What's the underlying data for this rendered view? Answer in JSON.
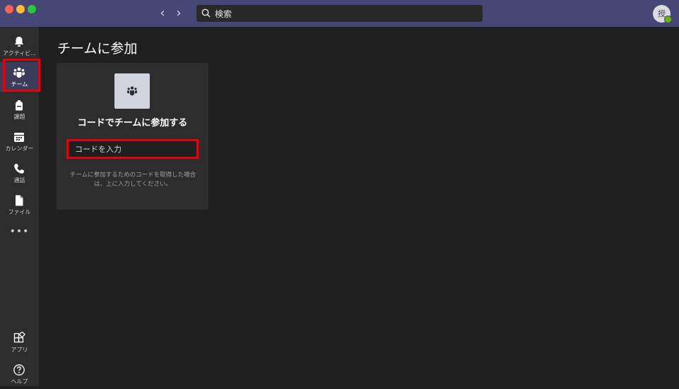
{
  "search": {
    "placeholder": "検索"
  },
  "avatar": {
    "initial": "授"
  },
  "sidebar": {
    "items": [
      {
        "label": "アクティビ..."
      },
      {
        "label": "チーム"
      },
      {
        "label": "課題"
      },
      {
        "label": "カレンダー"
      },
      {
        "label": "通話"
      },
      {
        "label": "ファイル"
      }
    ],
    "more_label": "•••",
    "bottom": [
      {
        "label": "アプリ"
      },
      {
        "label": "ヘルプ"
      }
    ]
  },
  "main": {
    "title": "チームに参加",
    "card": {
      "heading": "コードでチームに参加する",
      "input_placeholder": "コードを入力",
      "help_text": "チームに参加するためのコードを取得した場合は、上に入力してください。"
    }
  },
  "colors": {
    "titlebar": "#464775",
    "sidebar": "#2d2d2d",
    "background": "#1f1f1f",
    "highlight": "#e3000f"
  }
}
